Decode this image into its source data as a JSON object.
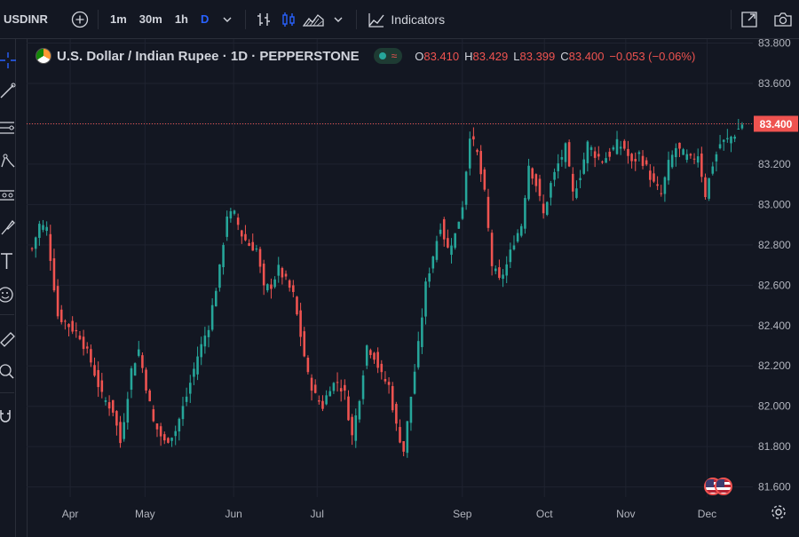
{
  "toolbar": {
    "symbol": "USDINR",
    "intervals": [
      "1m",
      "30m",
      "1h",
      "D"
    ],
    "active_interval": "D",
    "indicators_label": "Indicators"
  },
  "legend": {
    "title": "U.S. Dollar / Indian Rupee · 1D · PEPPERSTONE",
    "o_label": "O",
    "o_value": "83.410",
    "h_label": "H",
    "h_value": "83.429",
    "l_label": "L",
    "l_value": "83.399",
    "c_label": "C",
    "c_value": "83.400",
    "change": "−0.053 (−0.06%)"
  },
  "colors": {
    "up": "#26a69a",
    "down": "#ef5350",
    "background": "#131722",
    "grid": "#1f2330",
    "accent": "#2962ff"
  },
  "left_tools": [
    "crosshair-icon",
    "trend-line-icon",
    "fib-icon",
    "pattern-icon",
    "prediction-icon",
    "brush-icon",
    "text-icon",
    "emoji-icon",
    "ruler-icon",
    "zoom-icon",
    "magnet-icon"
  ],
  "chart_data": {
    "type": "candlestick",
    "series_name": "USDINR",
    "interval": "1D",
    "ylim": [
      81.55,
      83.82
    ],
    "y_ticks": [
      "83.800",
      "83.600",
      "83.400",
      "83.200",
      "83.000",
      "82.800",
      "82.600",
      "82.400",
      "82.200",
      "82.000",
      "81.800",
      "81.600"
    ],
    "x_ticks": [
      "Apr",
      "May",
      "Jun",
      "Jul",
      "Sep",
      "Oct",
      "Nov",
      "Dec"
    ],
    "last_price": "83.400",
    "close_path": [
      [
        0,
        82.78
      ],
      [
        2,
        82.9
      ],
      [
        4,
        82.88
      ],
      [
        7,
        82.45
      ],
      [
        10,
        82.4
      ],
      [
        13,
        82.35
      ],
      [
        16,
        82.22
      ],
      [
        19,
        82.05
      ],
      [
        22,
        81.98
      ],
      [
        24,
        81.82
      ],
      [
        27,
        82.18
      ],
      [
        29,
        82.28
      ],
      [
        31,
        82.1
      ],
      [
        33,
        81.92
      ],
      [
        36,
        81.82
      ],
      [
        39,
        81.88
      ],
      [
        42,
        82.05
      ],
      [
        45,
        82.25
      ],
      [
        48,
        82.4
      ],
      [
        51,
        82.68
      ],
      [
        53,
        82.95
      ],
      [
        55,
        82.95
      ],
      [
        57,
        82.85
      ],
      [
        59,
        82.8
      ],
      [
        61,
        82.78
      ],
      [
        63,
        82.58
      ],
      [
        65,
        82.6
      ],
      [
        67,
        82.68
      ],
      [
        69,
        82.62
      ],
      [
        71,
        82.55
      ],
      [
        73,
        82.35
      ],
      [
        75,
        82.15
      ],
      [
        77,
        82.05
      ],
      [
        79,
        82.0
      ],
      [
        81,
        82.1
      ],
      [
        83,
        82.12
      ],
      [
        85,
        82.06
      ],
      [
        87,
        81.85
      ],
      [
        89,
        82.05
      ],
      [
        91,
        82.3
      ],
      [
        93,
        82.25
      ],
      [
        95,
        82.15
      ],
      [
        97,
        82.1
      ],
      [
        99,
        81.9
      ],
      [
        101,
        81.78
      ],
      [
        103,
        82.05
      ],
      [
        105,
        82.3
      ],
      [
        107,
        82.6
      ],
      [
        109,
        82.75
      ],
      [
        111,
        82.9
      ],
      [
        113,
        82.78
      ],
      [
        115,
        82.85
      ],
      [
        117,
        83.0
      ],
      [
        119,
        83.35
      ],
      [
        121,
        83.25
      ],
      [
        123,
        83.05
      ],
      [
        125,
        82.7
      ],
      [
        127,
        82.62
      ],
      [
        129,
        82.7
      ],
      [
        131,
        82.82
      ],
      [
        133,
        82.9
      ],
      [
        135,
        83.2
      ],
      [
        137,
        83.1
      ],
      [
        139,
        82.95
      ],
      [
        141,
        83.1
      ],
      [
        143,
        83.2
      ],
      [
        145,
        83.28
      ],
      [
        147,
        83.05
      ],
      [
        149,
        83.15
      ],
      [
        151,
        83.3
      ],
      [
        153,
        83.25
      ],
      [
        155,
        83.22
      ],
      [
        157,
        83.25
      ],
      [
        159,
        83.3
      ],
      [
        161,
        83.28
      ],
      [
        163,
        83.2
      ],
      [
        165,
        83.25
      ],
      [
        167,
        83.18
      ],
      [
        169,
        83.1
      ],
      [
        171,
        83.05
      ],
      [
        173,
        83.2
      ],
      [
        175,
        83.28
      ],
      [
        177,
        83.25
      ],
      [
        179,
        83.22
      ],
      [
        181,
        83.25
      ],
      [
        183,
        83.05
      ],
      [
        185,
        83.2
      ],
      [
        187,
        83.3
      ],
      [
        189,
        83.32
      ],
      [
        191,
        83.35
      ],
      [
        193,
        83.4
      ]
    ]
  }
}
